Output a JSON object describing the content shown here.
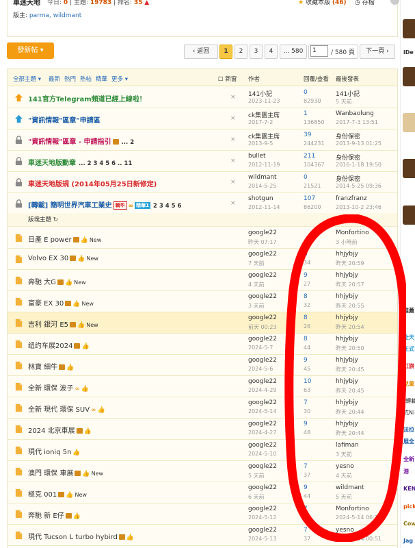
{
  "header": {
    "forum_title": "車迷天地",
    "stats": [
      {
        "label": "今日:",
        "value": "0"
      },
      {
        "label": "主題:",
        "value": "19783"
      },
      {
        "label": "排名:",
        "value": "35"
      }
    ],
    "favorite_label": "收藏本版",
    "favorite_count": "(46)",
    "rss_label": "存檔",
    "moderators_label": "版主:",
    "moderators": "parma, wildmant"
  },
  "toolbar": {
    "new_post_label": "發新帖 ▾",
    "back_label": "‹ 返回",
    "pages": [
      "1",
      "2",
      "3",
      "4",
      "... 580"
    ],
    "page_input": "1",
    "page_total": "/ 580 頁",
    "next_label": "下一頁 ›"
  },
  "table_header": {
    "filter_all": "全部主題 ▾",
    "filter_latest": "最新",
    "filter_hot": "熱門",
    "filter_hot_posts": "熱帖",
    "filter_digest": "精華",
    "filter_more": "更多 ▾",
    "new_window": "新窗",
    "author": "作者",
    "replies_views": "回覆/查看",
    "last_post": "最後發表"
  },
  "section_label": "版塊主題",
  "sticky_threads": [
    {
      "title": "141官方Telegram頻道已經上線啦！",
      "color": "grn",
      "icon": "sticky-global",
      "author": "141小記",
      "date": "2023-11-23",
      "replies": "0",
      "views": "82930",
      "last_user": "141小記",
      "last_time": "5 天前"
    },
    {
      "title": "\"資訊情報\"區章\"申請區",
      "color": "blu",
      "icon": "sticky-category",
      "author": "ck集團主席",
      "date": "2017-7-2",
      "replies": "1",
      "views": "136850",
      "last_user": "Wanbaolung",
      "last_time": "2017-7-3 13:51"
    },
    {
      "title": "\"資訊情報\"區章 - 申請指引",
      "color": "pink",
      "icon": "lock",
      "pages": "... 2",
      "author": "ck集團主席",
      "date": "2013-9-5",
      "replies": "39",
      "views": "244231",
      "last_user": "身份保密",
      "last_time": "2013-9-13 01:25"
    },
    {
      "title": "車迷天地版勳章",
      "color": "grn",
      "icon": "lock",
      "pages": "... 2 3 4 5 6 .. 11",
      "author": "bullet",
      "date": "2012-11-19",
      "replies": "211",
      "views": "104367",
      "last_user": "身份保密",
      "last_time": "2016-1-18 19:50"
    },
    {
      "title": "車迷天地版規 (2014年05月25日新修定)",
      "color": "red",
      "icon": "lock",
      "author": "wildmant",
      "date": "2014-5-25",
      "replies": "0",
      "views": "21521",
      "last_user": "身份保密",
      "last_time": "2014-5-25 09:36"
    },
    {
      "title": "[轉載] 簡明世界汽車工業史",
      "color": "blu",
      "icon": "lock",
      "tag1": "轎华",
      "tag2": "精華1",
      "pages": "2 3 4 5 6",
      "author": "shotgun",
      "date": "2012-11-14",
      "replies": "107",
      "views": "86200",
      "last_user": "franzfranz",
      "last_time": "2013-10-2 23:46"
    }
  ],
  "threads": [
    {
      "title": "日產 E power",
      "new": "New",
      "author": "google22",
      "date": "昨天 07:17",
      "replies": "",
      "views": "",
      "last_user": "Monfortino",
      "last_time": "3 小時前"
    },
    {
      "title": "Volvo EX 30",
      "new": "New",
      "author": "google22",
      "date": "7 天前",
      "replies": "8",
      "views": "34",
      "last_user": "hhjybjy",
      "last_time": "昨天 20:59"
    },
    {
      "title": "奔馳 大G",
      "new": "New",
      "author": "google22",
      "date": "4 天前",
      "replies": "9",
      "views": "27",
      "last_user": "hhjybjy",
      "last_time": "昨天 20:57"
    },
    {
      "title": "富豪 EX 30",
      "new": "New",
      "author": "google22",
      "date": "3 天前",
      "replies": "8",
      "views": "32",
      "last_user": "hhjybjy",
      "last_time": "昨天 20:55"
    },
    {
      "title": "吉利 銀河 E5",
      "new": "New",
      "author": "google22",
      "date": "前天 00:23",
      "replies": "8",
      "views": "26",
      "last_user": "hhjybjy",
      "last_time": "昨天 20:54",
      "hl": true
    },
    {
      "title": "纽约车展2024",
      "new": "",
      "author": "google22",
      "date": "2024-5-7",
      "replies": "8",
      "views": "44",
      "last_user": "hhjybjy",
      "last_time": "昨天 20:50"
    },
    {
      "title": "林寶 細牛",
      "new": "",
      "author": "google22",
      "date": "2024-5-6",
      "replies": "9",
      "views": "45",
      "last_user": "hhjybjy",
      "last_time": "昨天 20:45"
    },
    {
      "title": "全新 環保 波子",
      "new": "",
      "author": "google22",
      "date": "2024-4-29",
      "replies": "10",
      "views": "63",
      "last_user": "hhjybjy",
      "last_time": "昨天 20:45"
    },
    {
      "title": "全新 現代 環保 SUV",
      "new": "",
      "author": "google22",
      "date": "2024-5-14",
      "replies": "7",
      "views": "30",
      "last_user": "hhjybjy",
      "last_time": "昨天 20:44"
    },
    {
      "title": "2024 北京車展",
      "new": "",
      "author": "google22",
      "date": "2024-4-27",
      "replies": "9",
      "views": "48",
      "last_user": "hhjybjy",
      "last_time": "昨天 20:44"
    },
    {
      "title": "現代 ioniq 5n",
      "new": "",
      "author": "google22",
      "date": "2024-5-10",
      "replies": "",
      "views": "",
      "last_user": "lafiman",
      "last_time": "3 天前"
    },
    {
      "title": "澳門 環保 車展",
      "new": "New",
      "author": "google22",
      "date": "5 天前",
      "replies": "7",
      "views": "37",
      "last_user": "yesno",
      "last_time": "4 天前"
    },
    {
      "title": "極克 001",
      "new": "New",
      "author": "google22",
      "date": "6 天前",
      "replies": "9",
      "views": "44",
      "last_user": "wildmant",
      "last_time": "5 天前"
    },
    {
      "title": "奔馳 新 E仔",
      "new": "",
      "author": "google22",
      "date": "2024-5-12",
      "replies": "7",
      "views": "45",
      "last_user": "Monfortino",
      "last_time": "2024-5-14 06:19"
    },
    {
      "title": "現代 Tucson L turbo hybird",
      "new": "",
      "author": "google22",
      "date": "2024-5-13",
      "replies": "7",
      "views": "37",
      "last_user": "yesno",
      "last_time": "2024-5-14 00:51"
    }
  ],
  "sidebar": {
    "labels": [
      "iDe",
      "推薦",
      "全天",
      "正式",
      "紅旗",
      "兒童",
      "[轉載",
      "式Ni",
      "法拉",
      "展全",
      "全新",
      "港",
      "KEN",
      "pick",
      "Cow",
      "Jag"
    ]
  },
  "colors": {
    "accent": "#f39c12",
    "annotation": "#ff0000",
    "link": "#2a6ebb"
  }
}
